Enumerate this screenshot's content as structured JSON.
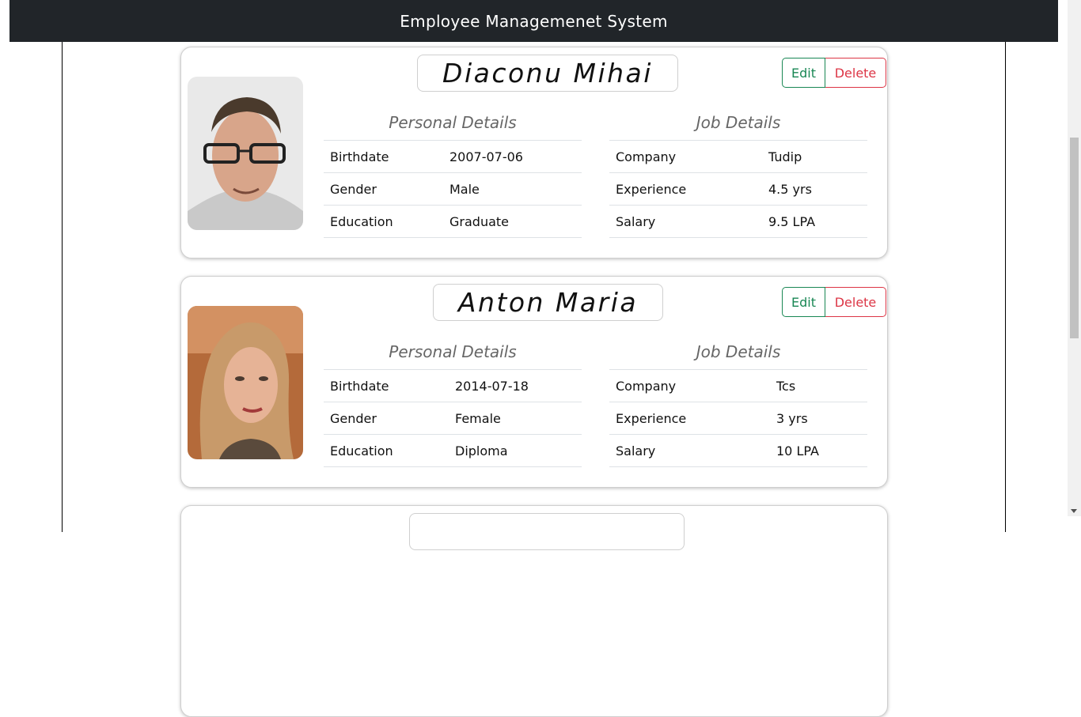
{
  "app": {
    "title": "Employee Managemenet System"
  },
  "labels": {
    "edit": "Edit",
    "delete": "Delete",
    "personal_details": "Personal Details",
    "job_details": "Job Details",
    "birthdate": "Birthdate",
    "gender": "Gender",
    "education": "Education",
    "company": "Company",
    "experience": "Experience",
    "salary": "Salary"
  },
  "employees": [
    {
      "name": "Diaconu Mihai",
      "birthdate": "2007-07-06",
      "gender": "Male",
      "education": "Graduate",
      "company": "Tudip",
      "experience": "4.5 yrs",
      "salary": "9.5 LPA"
    },
    {
      "name": "Anton Maria",
      "birthdate": "2014-07-18",
      "gender": "Female",
      "education": "Diploma",
      "company": "Tcs",
      "experience": "3 yrs",
      "salary": "10 LPA"
    }
  ],
  "colors": {
    "navbar": "#212529",
    "edit": "#198754",
    "delete": "#dc3545"
  }
}
